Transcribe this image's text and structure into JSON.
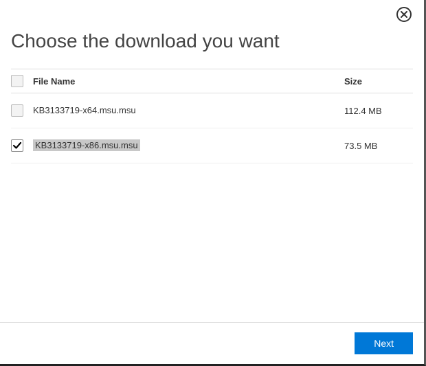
{
  "title": "Choose the download you want",
  "columns": {
    "name": "File Name",
    "size": "Size"
  },
  "files": [
    {
      "name": "KB3133719-x64.msu.msu",
      "size": "112.4 MB",
      "checked": false
    },
    {
      "name": "KB3133719-x86.msu.msu",
      "size": "73.5 MB",
      "checked": true
    }
  ],
  "buttons": {
    "next": "Next"
  }
}
